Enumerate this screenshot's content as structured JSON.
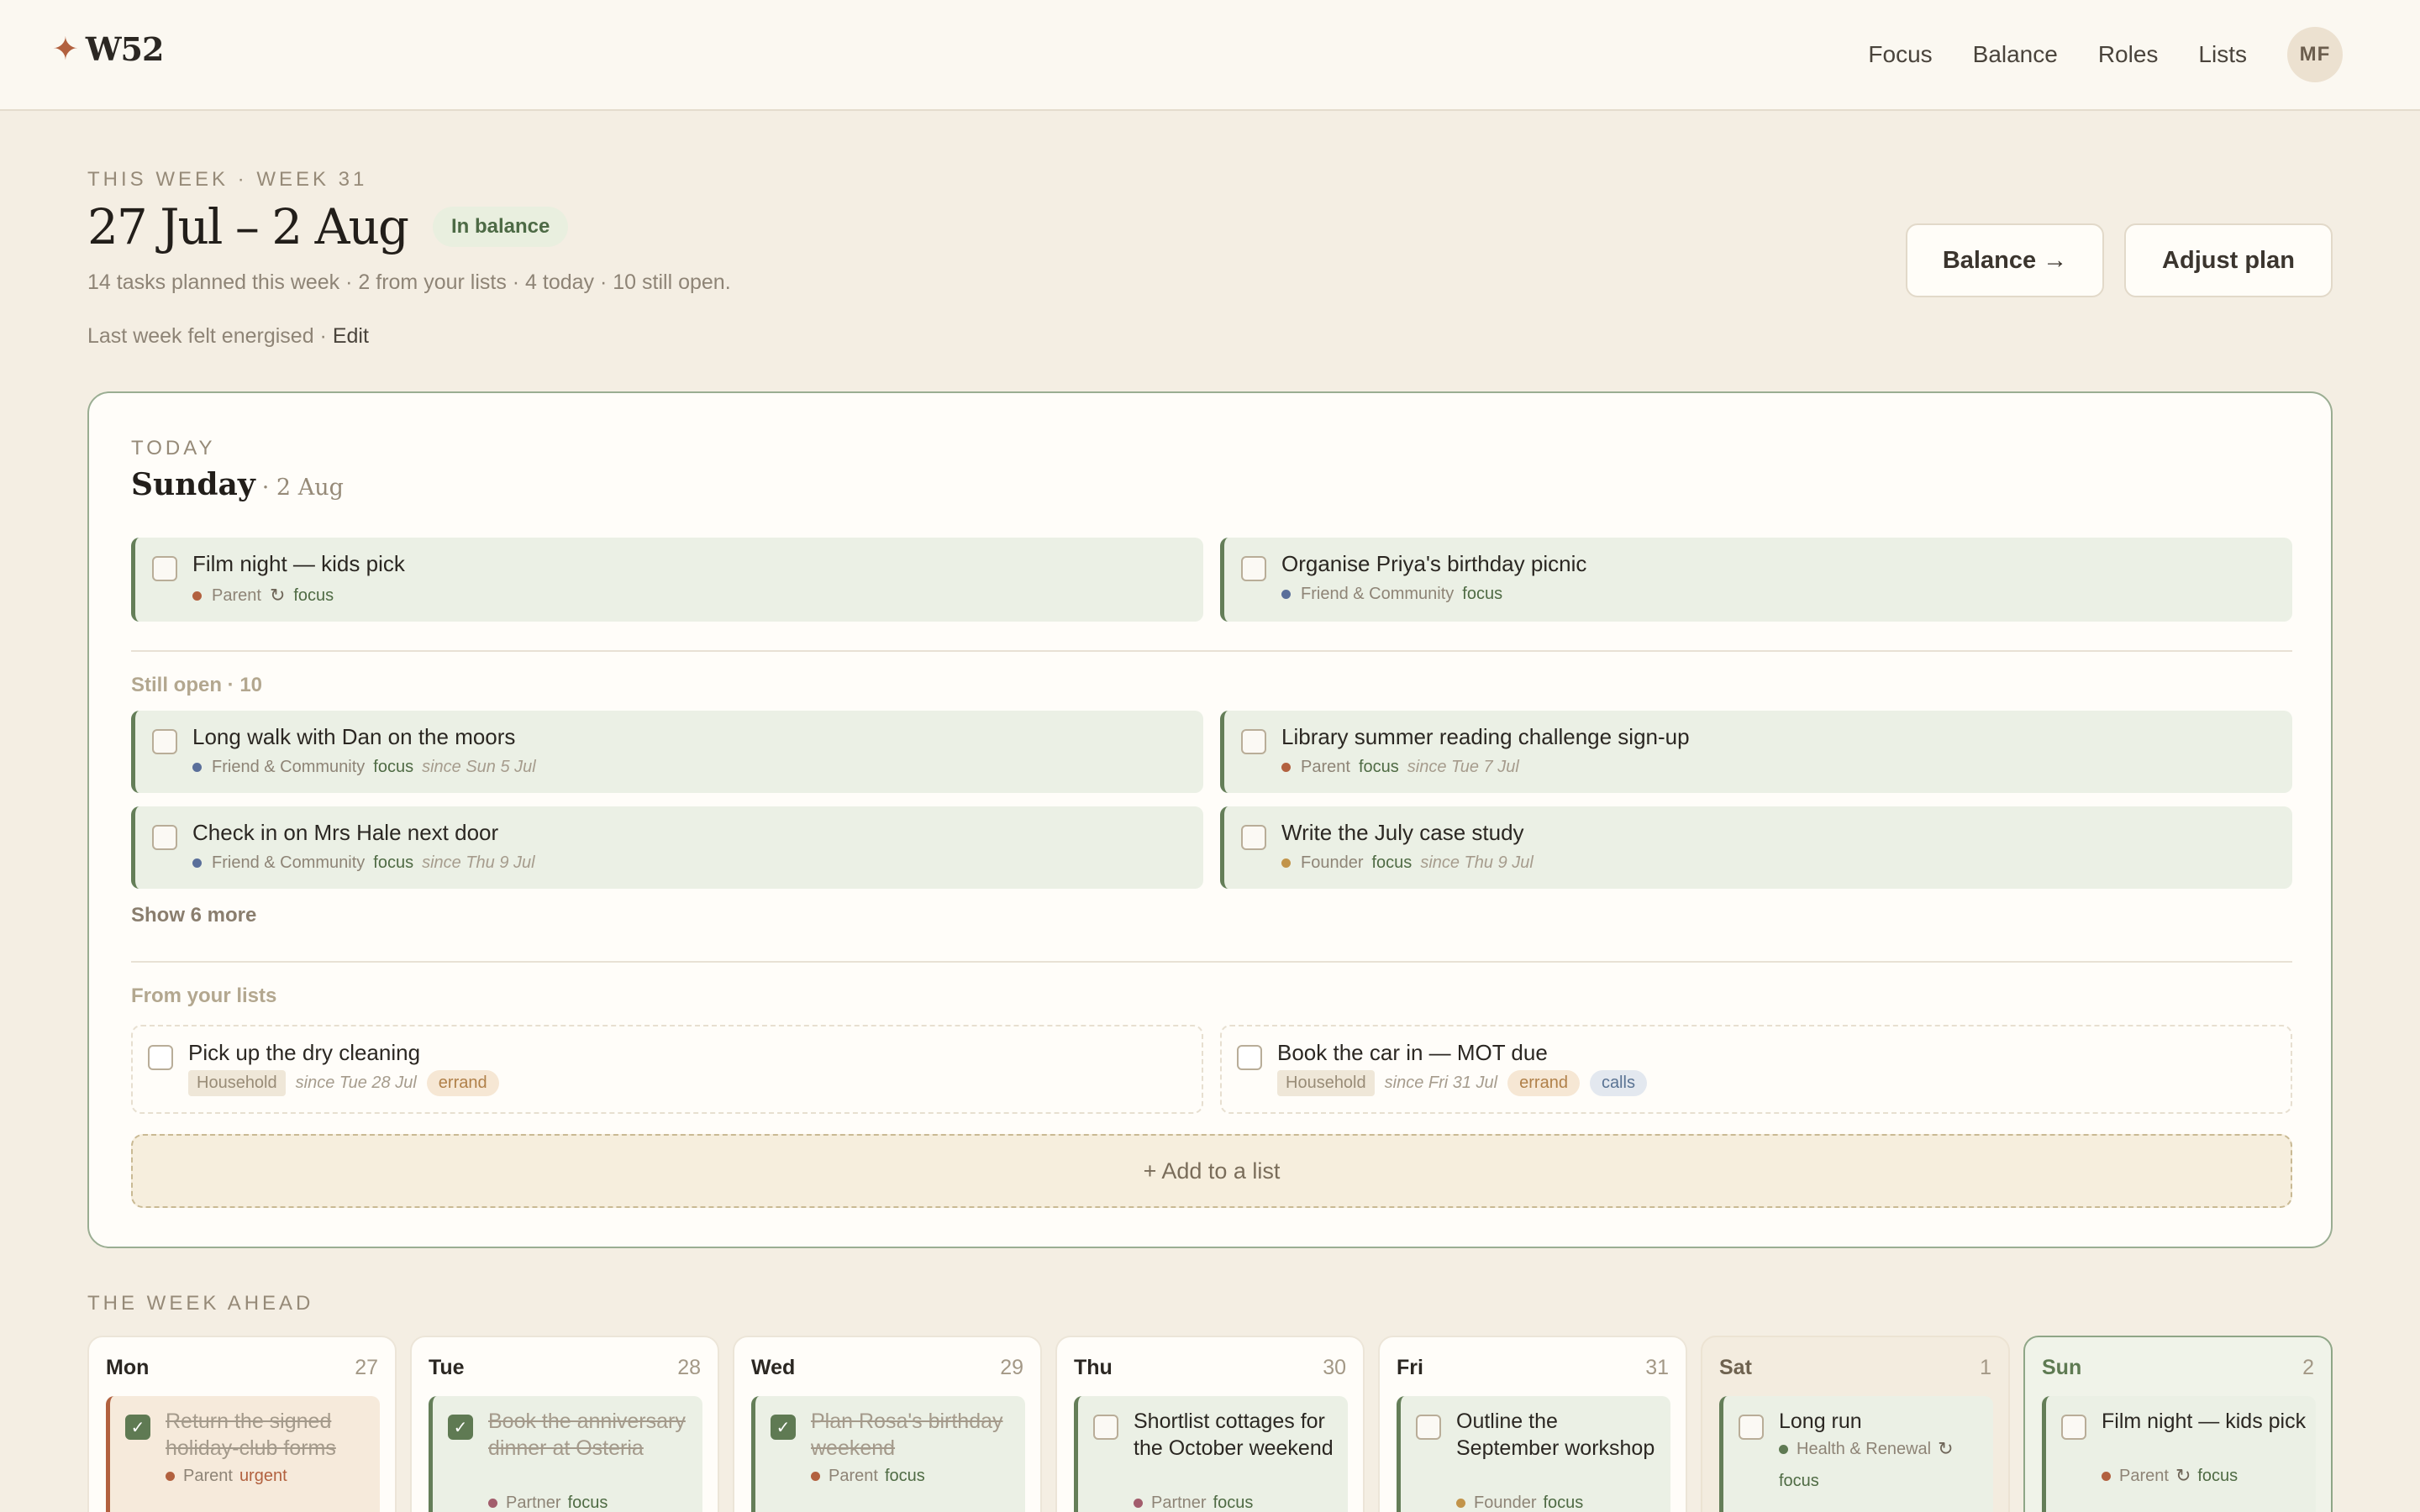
{
  "app": {
    "logo_glyph": "✦",
    "name": "W52"
  },
  "nav": {
    "items": [
      "Focus",
      "Balance",
      "Roles",
      "Lists"
    ],
    "avatar_initials": "MF"
  },
  "week": {
    "eyebrow": "THIS WEEK · WEEK 31",
    "range": "27 Jul – 2 Aug",
    "balance_badge": "In balance",
    "summary": "14 tasks planned this week · 2 from your lists · 4 today · 10 still open.",
    "feeling_text": "Last week felt energised ·",
    "feeling_edit": "Edit",
    "balance_button": "Balance →",
    "adjust_button": "Adjust plan"
  },
  "colors": {
    "accent": "#b2613f",
    "focus_green": "#647e58",
    "parent": "#b2613f",
    "friend_community": "#5a6f9a",
    "founder": "#c2944a",
    "partner": "#a25d6c",
    "health": "#5f7a53"
  },
  "today": {
    "label": "TODAY",
    "day": "Sunday",
    "date": "· 2 Aug",
    "tasks": [
      {
        "title": "Film night — kids pick",
        "role": "Parent",
        "repeat": "↻",
        "tag": "focus",
        "since": ""
      },
      {
        "title": "Organise Priya's birthday picnic",
        "role": "Friend & Community",
        "repeat": "",
        "tag": "focus",
        "since": ""
      }
    ],
    "still_open_label": "Still open · 10",
    "still_open": [
      {
        "title": "Long walk with Dan on the moors",
        "role": "Friend & Community",
        "tag": "focus",
        "since": "since Sun 5 Jul"
      },
      {
        "title": "Library summer reading challenge sign-up",
        "role": "Parent",
        "tag": "focus",
        "since": "since Tue 7 Jul"
      },
      {
        "title": "Check in on Mrs Hale next door",
        "role": "Friend & Community",
        "tag": "focus",
        "since": "since Thu 9 Jul"
      },
      {
        "title": "Write the July case study",
        "role": "Founder",
        "tag": "focus",
        "since": "since Thu 9 Jul"
      }
    ],
    "show_more": "Show 6 more",
    "lists_label": "From your lists",
    "list_tasks": [
      {
        "title": "Pick up the dry cleaning",
        "list": "Household",
        "since": "since Tue 28 Jul",
        "tags": [
          "errand"
        ]
      },
      {
        "title": "Book the car in — MOT due",
        "list": "Household",
        "since": "since Fri 31 Jul",
        "tags": [
          "errand",
          "calls"
        ]
      }
    ],
    "add_to_list": "+ Add to a list"
  },
  "week_ahead": {
    "label": "THE WEEK AHEAD",
    "days": [
      {
        "name": "Mon",
        "num": "27",
        "task": "Return the signed holiday-club forms",
        "done": true,
        "role": "Parent",
        "tag": "urgent",
        "repeat": ""
      },
      {
        "name": "Tue",
        "num": "28",
        "task": "Book the anniversary dinner at Osteria",
        "done": true,
        "role": "Partner",
        "tag": "focus",
        "repeat": ""
      },
      {
        "name": "Wed",
        "num": "29",
        "task": "Plan Rosa's birthday weekend",
        "done": true,
        "role": "Parent",
        "tag": "focus",
        "repeat": ""
      },
      {
        "name": "Thu",
        "num": "30",
        "task": "Shortlist cottages for the October weekend",
        "done": false,
        "role": "Partner",
        "tag": "focus",
        "repeat": ""
      },
      {
        "name": "Fri",
        "num": "31",
        "task": "Outline the September workshop",
        "done": false,
        "role": "Founder",
        "tag": "focus",
        "repeat": ""
      },
      {
        "name": "Sat",
        "num": "1",
        "task": "Long run",
        "done": false,
        "role": "Health & Renewal",
        "tag": "focus",
        "repeat": "↻"
      },
      {
        "name": "Sun",
        "num": "2",
        "task": "Film night — kids pick",
        "done": false,
        "role": "Parent",
        "tag": "focus",
        "repeat": "↻"
      }
    ]
  },
  "icons": {
    "logo": "star-icon",
    "check": "check-icon",
    "repeat": "repeat-icon",
    "arrow": "arrow-right-icon"
  }
}
